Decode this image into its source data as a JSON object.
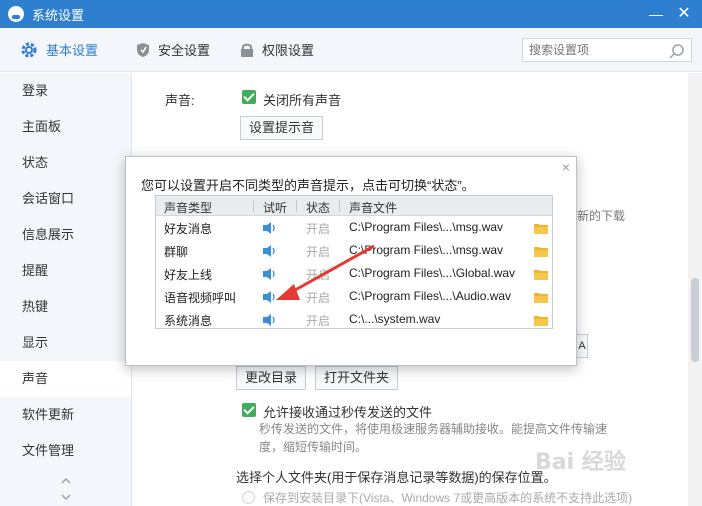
{
  "window": {
    "title": "系统设置",
    "minimize": "—",
    "close": "✕"
  },
  "tabs": [
    {
      "label": "基本设置",
      "icon": "gear-icon",
      "active": true
    },
    {
      "label": "安全设置",
      "icon": "shield-icon",
      "active": false
    },
    {
      "label": "权限设置",
      "icon": "lock-icon",
      "active": false
    }
  ],
  "search": {
    "placeholder": "搜索设置项"
  },
  "sidebar": {
    "items": [
      {
        "label": "登录"
      },
      {
        "label": "主面板"
      },
      {
        "label": "状态"
      },
      {
        "label": "会话窗口"
      },
      {
        "label": "信息展示"
      },
      {
        "label": "提醒"
      },
      {
        "label": "热键"
      },
      {
        "label": "显示"
      },
      {
        "label": "声音",
        "active": true
      },
      {
        "label": "软件更新"
      },
      {
        "label": "文件管理"
      }
    ]
  },
  "main": {
    "sound_label": "声音:",
    "mute_all": "关闭所有声音",
    "set_tone_button": "设置提示音",
    "partial_right_text": "新的下载",
    "partial_right_glyph": "A",
    "change_dir_button": "更改目录",
    "open_folder_button": "打开文件夹",
    "allow_instant": "允许接收通过秒传发送的文件",
    "instant_desc_1": "秒传发送的文件，将使用极速服务器辅助接收。能提高文件传输速",
    "instant_desc_2": "度，缩短传输时间。",
    "personal_folder": "选择个人文件夹(用于保存消息记录等数据)的保存位置。",
    "save_install_dir": "保存到安装目录下(Vista、Windows 7或更高版本的系统不支持此选项)"
  },
  "popup": {
    "close": "×",
    "message": "您可以设置开启不同类型的声音提示，点击可切换“状态”。",
    "columns": [
      "声音类型",
      "试听",
      "状态",
      "声音文件"
    ],
    "rows": [
      {
        "type": "好友消息",
        "status": "开启",
        "file": "C:\\Program Files\\...\\msg.wav"
      },
      {
        "type": "群聊",
        "status": "开启",
        "file": "C:\\Program Files\\...\\msg.wav"
      },
      {
        "type": "好友上线",
        "status": "开启",
        "file": "C:\\Program Files\\...\\Global.wav"
      },
      {
        "type": "语音视频呼叫",
        "status": "开启",
        "file": "C:\\Program Files\\...\\Audio.wav"
      },
      {
        "type": "系统消息",
        "status": "开启",
        "file": "C:\\...\\system.wav"
      }
    ]
  },
  "watermark": "Bai 经验",
  "colors": {
    "accent": "#2f7fd1",
    "check": "#3fae5b",
    "arrow": "#e53935",
    "speaker": "#3b8fd8",
    "folder": "#f0b429"
  }
}
